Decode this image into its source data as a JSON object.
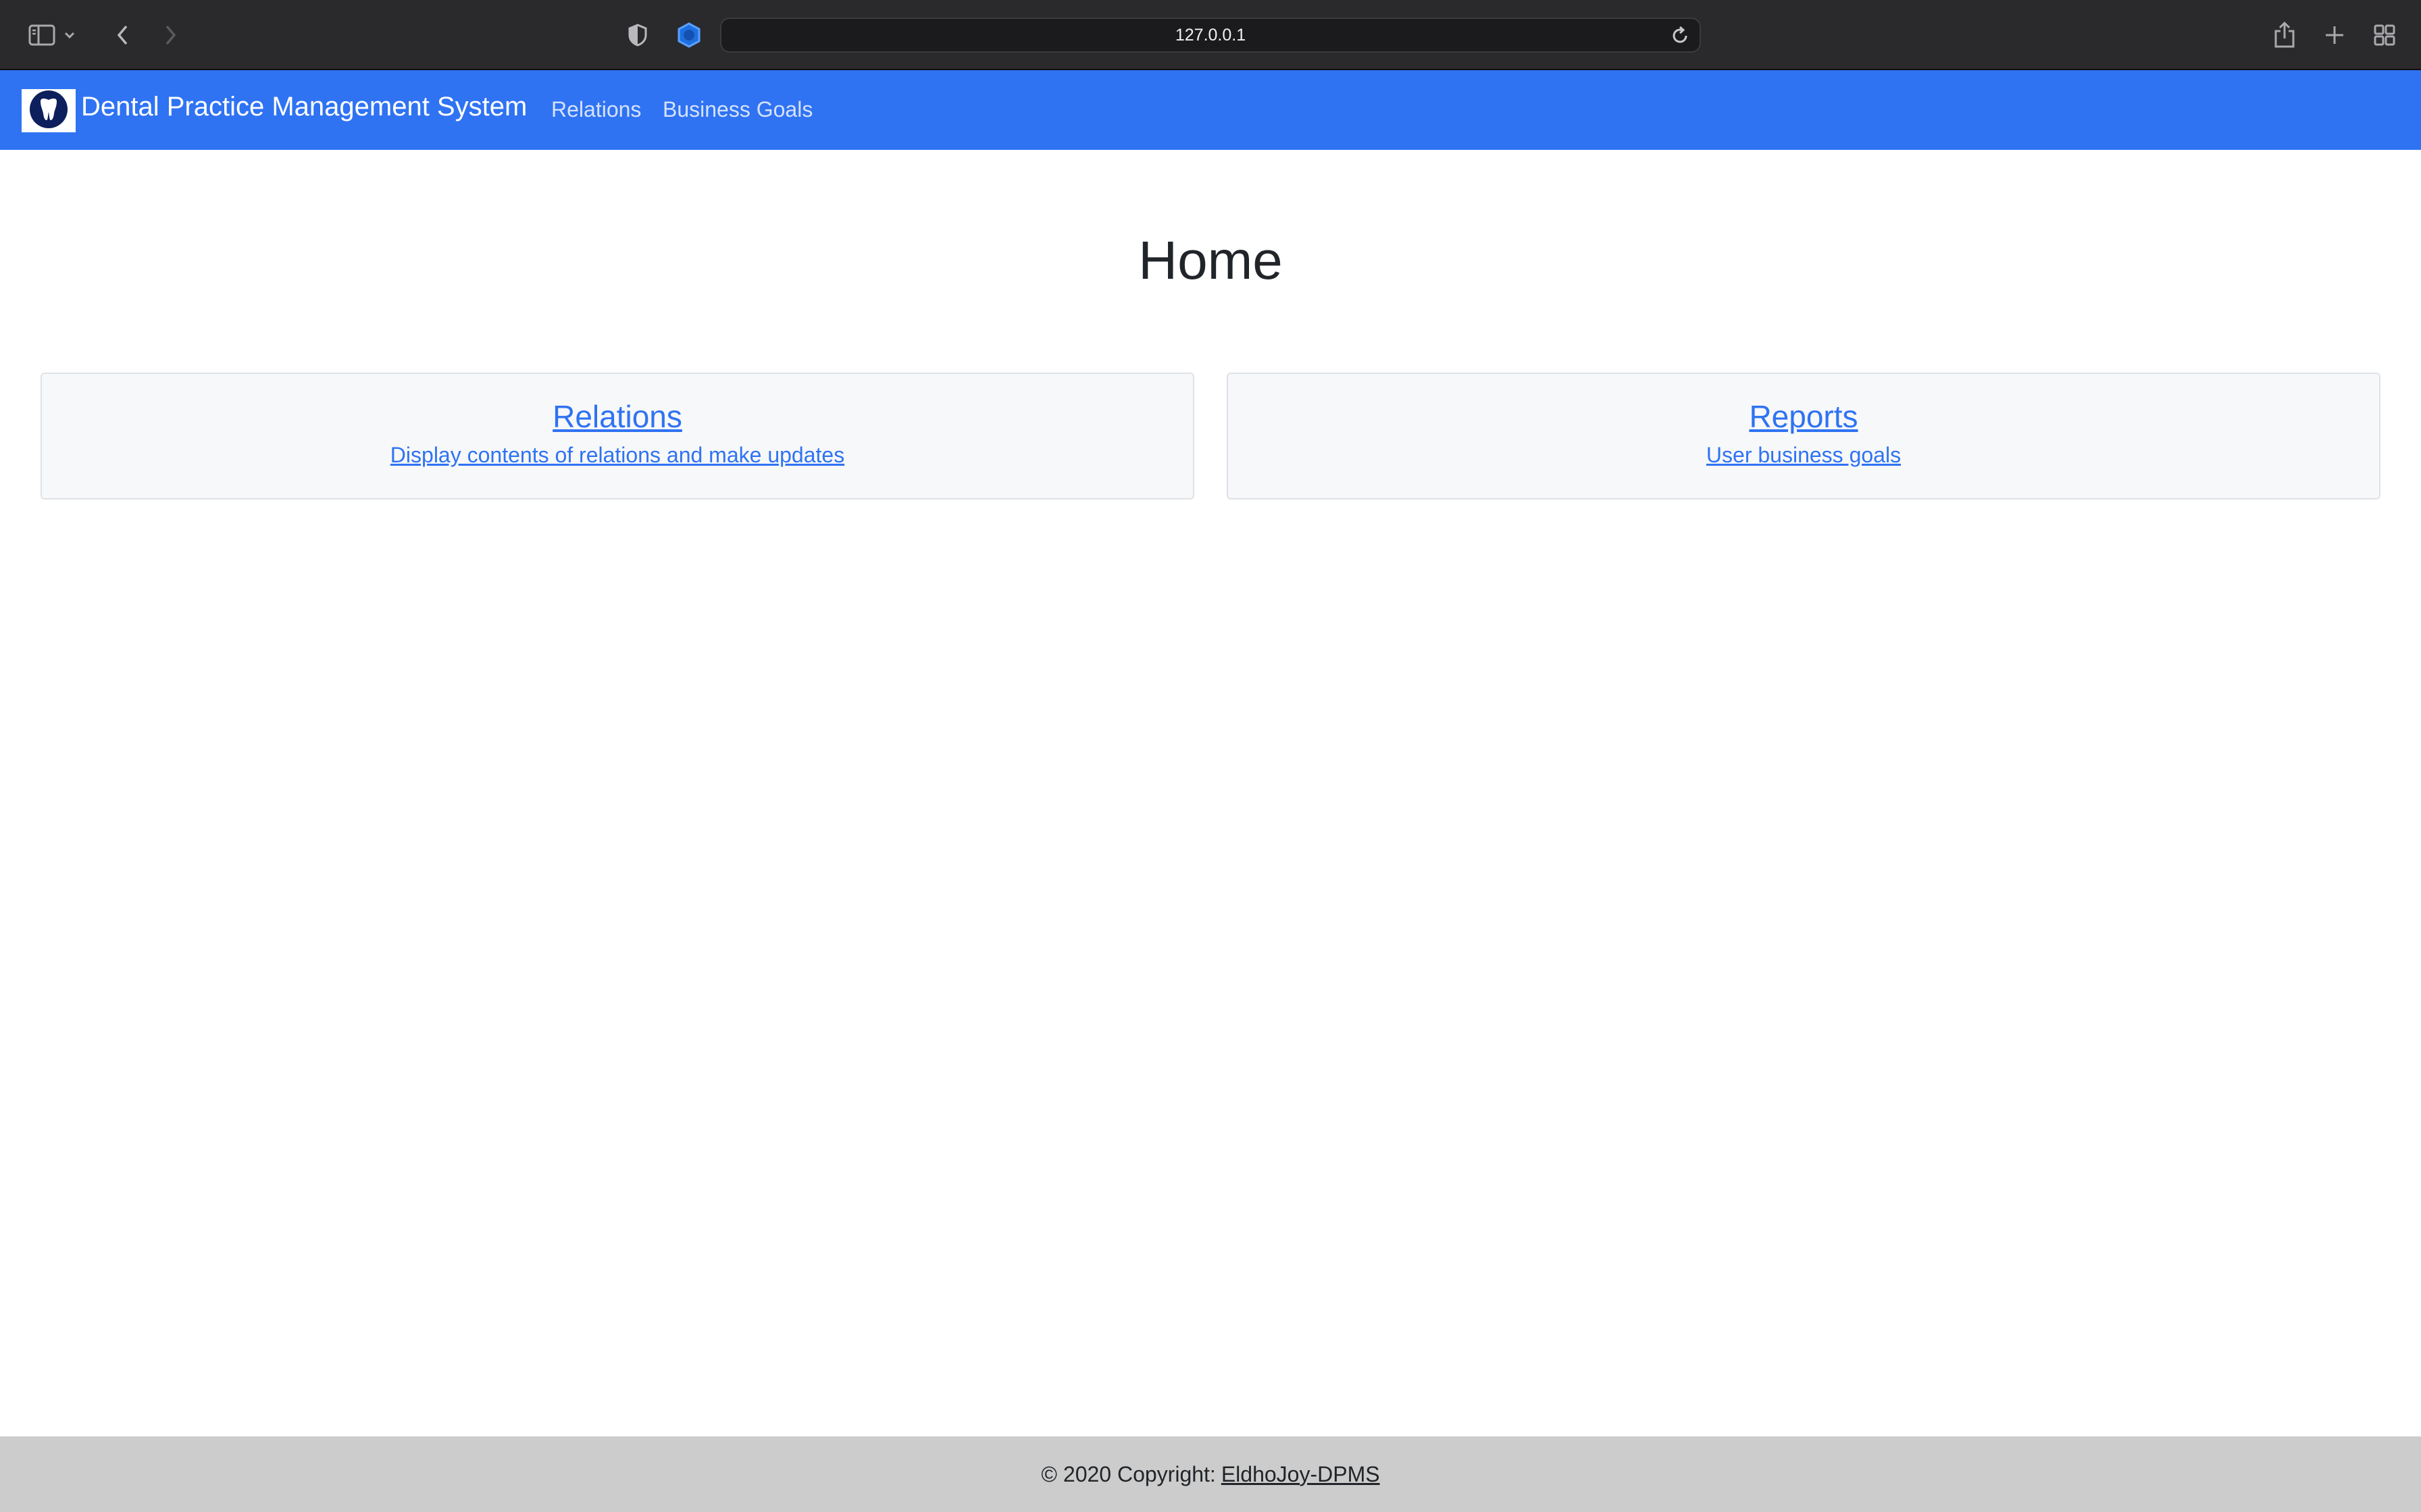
{
  "browser": {
    "url": "127.0.0.1",
    "icons": [
      "sidebar-icon",
      "chevron-down-icon",
      "back-icon",
      "forward-icon",
      "shield-icon",
      "extension-icon",
      "reload-icon",
      "share-icon",
      "new-tab-icon",
      "tab-overview-icon"
    ]
  },
  "navbar": {
    "brand": "Dental Practice Management System",
    "logo_icon": "tooth-icon",
    "links": [
      {
        "label": "Relations"
      },
      {
        "label": "Business Goals"
      }
    ]
  },
  "main": {
    "title": "Home",
    "cards": [
      {
        "title": "Relations",
        "description": "Display contents of relations and make updates"
      },
      {
        "title": "Reports",
        "description": "User business goals"
      }
    ]
  },
  "footer": {
    "prefix": "© 2020 Copyright:",
    "link": "EldhoJoy-DPMS"
  },
  "colors": {
    "navbar": "#2f73f3",
    "link": "#2f73f3",
    "footer": "#cccccc",
    "chrome": "#2a2a2c"
  }
}
